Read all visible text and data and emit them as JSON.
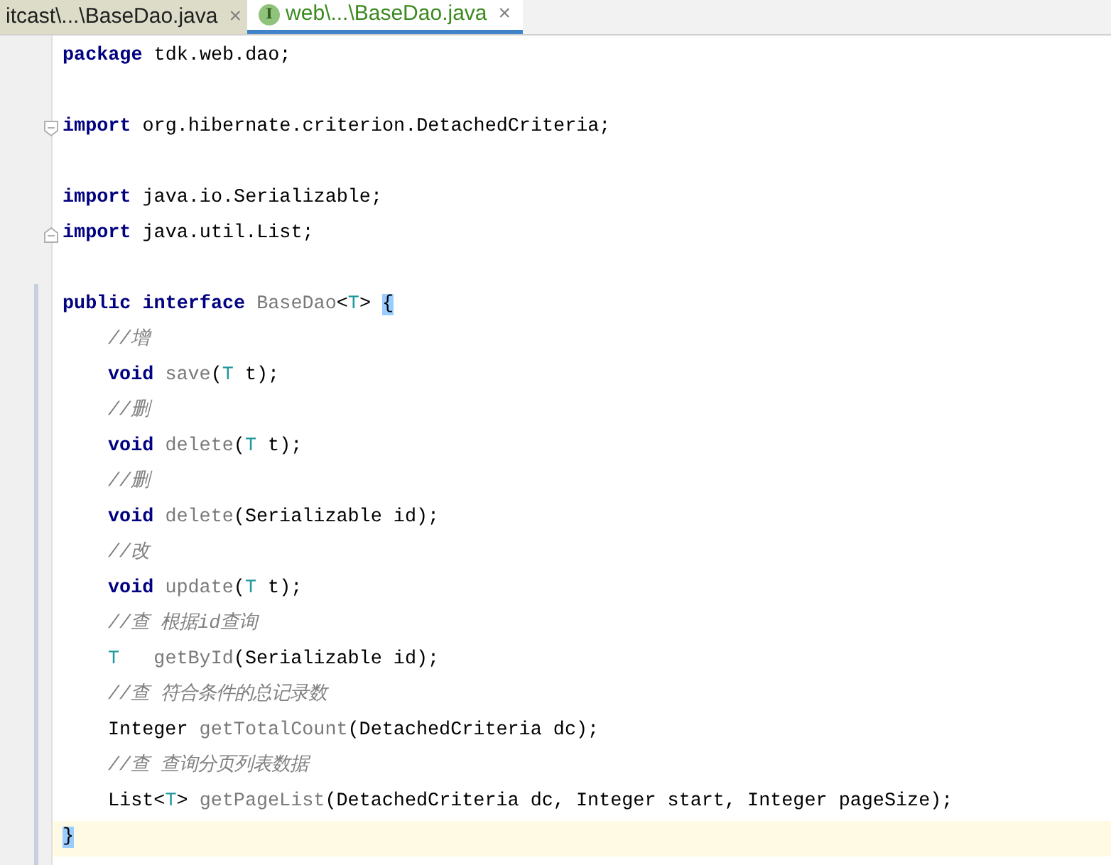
{
  "tabs": [
    {
      "label": "itcast\\...\\BaseDao.java",
      "selected": false,
      "close": "×"
    },
    {
      "label": "web\\...\\BaseDao.java",
      "selected": true,
      "close": "×",
      "icon_letter": "I"
    }
  ],
  "lines": [
    {
      "current": false,
      "tokens": [
        {
          "kind": "keyword",
          "text": "package "
        },
        {
          "kind": "plain",
          "text": "tdk.web.dao;"
        }
      ]
    },
    {
      "current": false
    },
    {
      "current": false,
      "fold_start": true,
      "tokens": [
        {
          "kind": "keyword",
          "text": "import "
        },
        {
          "kind": "plain",
          "text": "org.hibernate.criterion.DetachedCriteria;"
        }
      ]
    },
    {
      "current": false
    },
    {
      "current": false,
      "tokens": [
        {
          "kind": "keyword",
          "text": "import "
        },
        {
          "kind": "plain",
          "text": "java.io.Serializable;"
        }
      ]
    },
    {
      "current": false,
      "fold_end": true,
      "tokens": [
        {
          "kind": "keyword",
          "text": "import "
        },
        {
          "kind": "plain",
          "text": "java.util.List;"
        }
      ]
    },
    {
      "current": false
    },
    {
      "current": false,
      "tokens": [
        {
          "kind": "keyword",
          "text": "public interface "
        },
        {
          "kind": "unused",
          "text": "BaseDao"
        },
        {
          "kind": "plain",
          "text": "<"
        },
        {
          "kind": "type_param",
          "text": "T"
        },
        {
          "kind": "plain",
          "text": "> "
        },
        {
          "kind": "brace_match",
          "text": "{"
        }
      ]
    },
    {
      "current": false,
      "indented": true,
      "tokens": [
        {
          "kind": "comment",
          "text": "//增"
        }
      ]
    },
    {
      "current": false,
      "indented": true,
      "tokens": [
        {
          "kind": "keyword",
          "text": "void "
        },
        {
          "kind": "unused",
          "text": "save"
        },
        {
          "kind": "plain",
          "text": "("
        },
        {
          "kind": "type_param",
          "text": "T"
        },
        {
          "kind": "plain",
          "text": " t);"
        }
      ]
    },
    {
      "current": false,
      "indented": true,
      "tokens": [
        {
          "kind": "comment",
          "text": "//删"
        }
      ]
    },
    {
      "current": false,
      "indented": true,
      "tokens": [
        {
          "kind": "keyword",
          "text": "void "
        },
        {
          "kind": "unused",
          "text": "delete"
        },
        {
          "kind": "plain",
          "text": "("
        },
        {
          "kind": "type_param",
          "text": "T"
        },
        {
          "kind": "plain",
          "text": " t);"
        }
      ]
    },
    {
      "current": false,
      "indented": true,
      "tokens": [
        {
          "kind": "comment",
          "text": "//删"
        }
      ]
    },
    {
      "current": false,
      "indented": true,
      "tokens": [
        {
          "kind": "keyword",
          "text": "void "
        },
        {
          "kind": "unused",
          "text": "delete"
        },
        {
          "kind": "plain",
          "text": "(Serializable id);"
        }
      ]
    },
    {
      "current": false,
      "indented": true,
      "tokens": [
        {
          "kind": "comment",
          "text": "//改"
        }
      ]
    },
    {
      "current": false,
      "indented": true,
      "tokens": [
        {
          "kind": "keyword",
          "text": "void "
        },
        {
          "kind": "unused",
          "text": "update"
        },
        {
          "kind": "plain",
          "text": "("
        },
        {
          "kind": "type_param",
          "text": "T"
        },
        {
          "kind": "plain",
          "text": " t);"
        }
      ]
    },
    {
      "current": false,
      "indented": true,
      "tokens": [
        {
          "kind": "comment",
          "text": "//查 根据id查询"
        }
      ]
    },
    {
      "current": false,
      "indented": true,
      "tokens": [
        {
          "kind": "type_param",
          "text": "T   "
        },
        {
          "kind": "unused",
          "text": "getById"
        },
        {
          "kind": "plain",
          "text": "(Serializable id);"
        }
      ]
    },
    {
      "current": false,
      "indented": true,
      "tokens": [
        {
          "kind": "comment",
          "text": "//查 符合条件的总记录数"
        }
      ]
    },
    {
      "current": false,
      "indented": true,
      "tokens": [
        {
          "kind": "plain",
          "text": "Integer "
        },
        {
          "kind": "unused",
          "text": "getTotalCount"
        },
        {
          "kind": "plain",
          "text": "(DetachedCriteria dc);"
        }
      ]
    },
    {
      "current": false,
      "indented": true,
      "tokens": [
        {
          "kind": "comment",
          "text": "//查 查询分页列表数据"
        }
      ]
    },
    {
      "current": false,
      "indented": true,
      "tokens": [
        {
          "kind": "plain",
          "text": "List<"
        },
        {
          "kind": "type_param",
          "text": "T"
        },
        {
          "kind": "plain",
          "text": "> "
        },
        {
          "kind": "unused",
          "text": "getPageList"
        },
        {
          "kind": "plain",
          "text": "(DetachedCriteria dc, Integer start, Integer pageSize);"
        }
      ]
    },
    {
      "current": true,
      "tokens": [
        {
          "kind": "brace_match",
          "text": "}"
        }
      ]
    }
  ]
}
